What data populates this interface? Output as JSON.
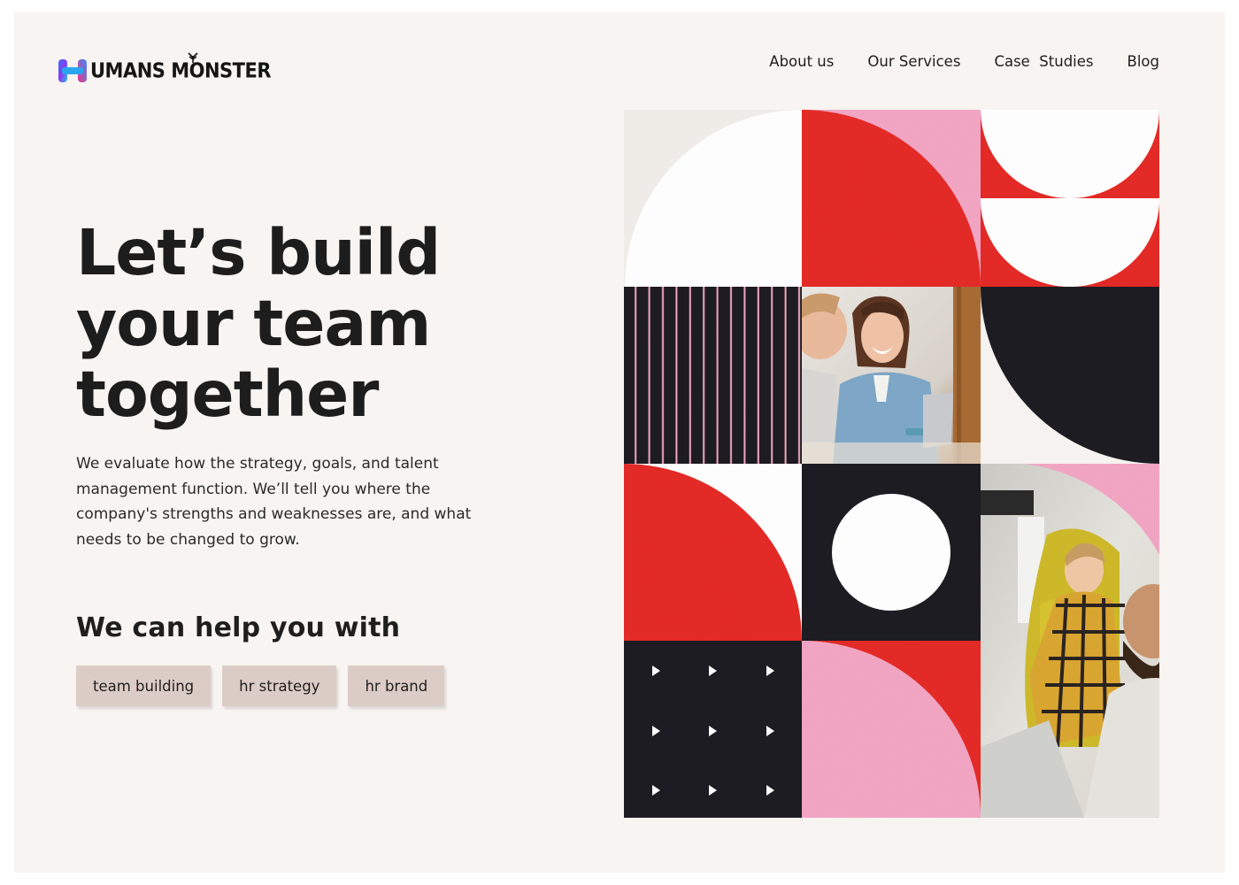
{
  "brand": {
    "name": "UMANS MONSTER",
    "logo_icon": "h-gradient-logo",
    "colors": {
      "red": "#e42b28",
      "pink": "#f3a6c3",
      "black": "#1f1f21",
      "cream": "#f7f4f1",
      "tag_bg": "#dcccc6"
    }
  },
  "nav": {
    "items": [
      {
        "label": "About us"
      },
      {
        "label": "Our Services"
      },
      {
        "label": "Case  Studies"
      },
      {
        "label": "Blog"
      }
    ]
  },
  "hero": {
    "title": "Let’s build\nyour team\ntogether",
    "description": "We evaluate how the strategy, goals, and talent management function. We’ll tell you where the company's strengths and weaknesses are, and what needs to be changed to grow.",
    "help_title": "We can help you with",
    "tags": [
      {
        "label": "team building"
      },
      {
        "label": "hr strategy"
      },
      {
        "label": "hr brand"
      }
    ]
  },
  "artwork": {
    "tiles": [
      {
        "name": "white-quarter-circle",
        "icon": "quarter-circle"
      },
      {
        "name": "red-quarter-circle-on-pink",
        "icon": "quarter-circle"
      },
      {
        "name": "white-semicircles-on-red",
        "icon": "semicircle"
      },
      {
        "name": "pink-striped-black",
        "icon": "stripes"
      },
      {
        "name": "photo-smiling-woman-laptop",
        "icon": "photo"
      },
      {
        "name": "black-quarter-circle",
        "icon": "quarter-circle"
      },
      {
        "name": "red-quarter-circle-on-white",
        "icon": "quarter-circle"
      },
      {
        "name": "white-circle-on-black",
        "icon": "circle"
      },
      {
        "name": "photo-woman-yellow-chair",
        "icon": "photo"
      },
      {
        "name": "play-arrows-on-black",
        "icon": "play-arrow"
      },
      {
        "name": "pink-quarter-circle-on-red",
        "icon": "quarter-circle"
      }
    ]
  }
}
